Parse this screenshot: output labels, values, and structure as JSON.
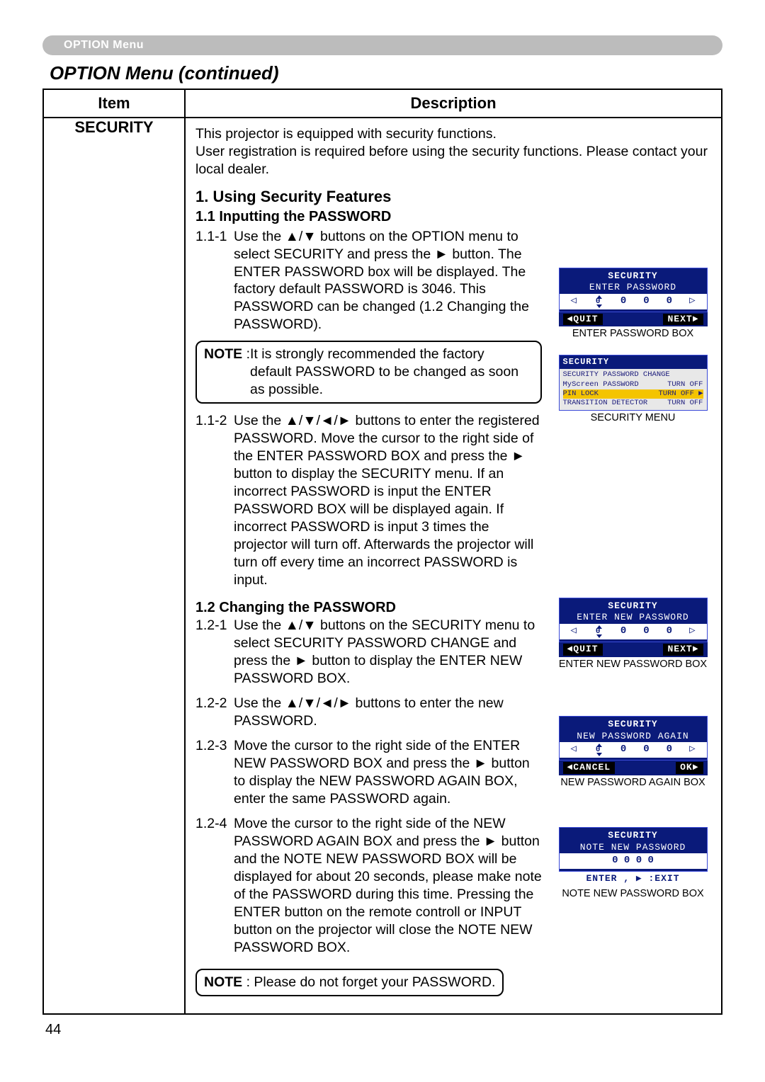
{
  "header": {
    "tab": "OPTION Menu",
    "title": "OPTION Menu (continued)"
  },
  "table": {
    "col1": "Item",
    "col2": "Description",
    "item": "SECURITY"
  },
  "intro": "This projector is equipped with security functions.\nUser registration is required before using the security functions. Please contact your local dealer.",
  "s1": {
    "h": "1. Using Security Features",
    "h11": "1.1 Inputting the PASSWORD",
    "p111_num": "1.1-1",
    "p111": "Use the ▲/▼ buttons on the OPTION menu to select SECURITY and press the ► button. The ENTER PASSWORD box will be displayed. The factory default PASSWORD is 3046. This PASSWORD can be changed (1.2 Changing the PASSWORD).",
    "note1_lead": "NOTE : ",
    "note1_first": "It is strongly recommended the factory",
    "note1_rest": "default PASSWORD to be changed as soon as possible.",
    "p112_num": "1.1-2",
    "p112": "Use the ▲/▼/◄/► buttons to enter the registered PASSWORD. Move the cursor to the right side of the ENTER PASSWORD BOX and press the ► button to display the SECURITY menu. If an incorrect PASSWORD is input the ENTER PASSWORD BOX will be displayed again. If incorrect PASSWORD is input 3 times the projector will turn off. Afterwards the projector will turn off every time an incorrect PASSWORD is input.",
    "h12": "1.2 Changing the PASSWORD",
    "p121_num": "1.2-1",
    "p121": "Use the ▲/▼ buttons on the SECURITY menu to select SECURITY PASSWORD CHANGE and press the ► button to display the ENTER NEW PASSWORD BOX.",
    "p122_num": "1.2-2",
    "p122": "Use the ▲/▼/◄/► buttons to enter the new PASSWORD.",
    "p123_num": "1.2-3",
    "p123": "Move the cursor to the right side of the ENTER NEW PASSWORD BOX and press the ► button to display the NEW PASSWORD AGAIN BOX, enter the same PASSWORD again.",
    "p124_num": "1.2-4",
    "p124": "Move the cursor to the right side of the NEW PASSWORD AGAIN BOX and press the ► button and the NOTE NEW PASSWORD BOX will be displayed for about 20 seconds, please make note of the PASSWORD during this time. Pressing the ENTER button on the remote controll or INPUT button on the projector will close the NOTE NEW PASSWORD BOX.",
    "note2": "NOTE : Please do not forget your PASSWORD."
  },
  "fig": {
    "box1": {
      "title": "SECURITY",
      "sub": "ENTER PASSWORD",
      "digits": [
        "0",
        "0",
        "0",
        "0"
      ],
      "quit": "◄QUIT",
      "next": "NEXT►",
      "caption": "ENTER PASSWORD BOX"
    },
    "menu": {
      "header": "SECURITY",
      "lines": [
        {
          "l": "SECURITY PASSWORD CHANGE",
          "r": ""
        },
        {
          "l": "MyScreen PASSWORD",
          "r": "TURN OFF"
        },
        {
          "l": "PIN LOCK",
          "r": "TURN OFF ▶",
          "hl": true
        },
        {
          "l": "TRANSITION DETECTOR",
          "r": "TURN OFF"
        }
      ],
      "caption": "SECURITY MENU"
    },
    "box2": {
      "title": "SECURITY",
      "sub": "ENTER NEW PASSWORD",
      "digits": [
        "0",
        "0",
        "0",
        "0"
      ],
      "quit": "◄QUIT",
      "next": "NEXT►",
      "caption": "ENTER NEW PASSWORD BOX"
    },
    "box3": {
      "title": "SECURITY",
      "sub": "NEW PASSWORD AGAIN",
      "digits": [
        "0",
        "0",
        "0",
        "0"
      ],
      "quit": "◄CANCEL",
      "next": "OK►",
      "caption": "NEW PASSWORD AGAIN BOX"
    },
    "box4": {
      "title": "SECURITY",
      "sub": "NOTE NEW PASSWORD",
      "digits_plain": "0  0  0  0",
      "exit": "ENTER , ▶ :EXIT",
      "caption": "NOTE NEW PASSWORD BOX"
    }
  },
  "page": "44"
}
